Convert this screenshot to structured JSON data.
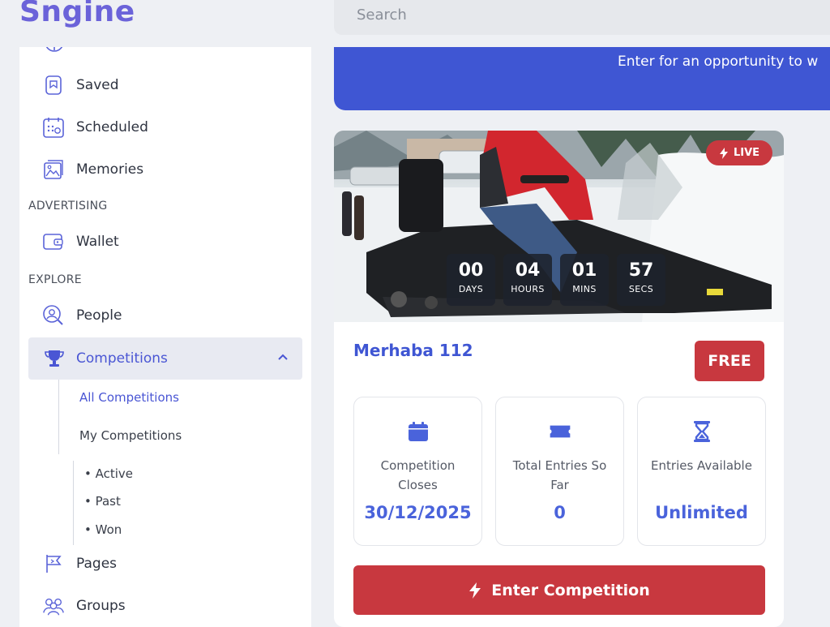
{
  "app": {
    "logo": "Sngine"
  },
  "search": {
    "placeholder": "Search"
  },
  "sidebar": {
    "items": [
      {
        "label": "Saved",
        "icon": "bookmark-icon"
      },
      {
        "label": "Scheduled",
        "icon": "calendar-icon"
      },
      {
        "label": "Memories",
        "icon": "photos-icon"
      }
    ],
    "section_advertising": "ADVERTISING",
    "wallet": {
      "label": "Wallet",
      "icon": "wallet-icon"
    },
    "section_explore": "EXPLORE",
    "people": {
      "label": "People",
      "icon": "people-search-icon"
    },
    "competitions": {
      "label": "Competitions",
      "icon": "trophy-icon",
      "expanded": true,
      "sub": {
        "all": "All Competitions",
        "mine": "My Competitions",
        "active": "• Active",
        "past": "• Past",
        "won": "• Won"
      }
    },
    "pages": {
      "label": "Pages",
      "icon": "flag-icon"
    },
    "groups": {
      "label": "Groups",
      "icon": "groups-icon"
    }
  },
  "banner": {
    "text": "Enter for an opportunity to w"
  },
  "competition": {
    "live_badge": "LIVE",
    "countdown": [
      {
        "value": "00",
        "unit": "DAYS"
      },
      {
        "value": "04",
        "unit": "HOURS"
      },
      {
        "value": "01",
        "unit": "MINS"
      },
      {
        "value": "57",
        "unit": "SECS"
      }
    ],
    "title": "Merhaba 112",
    "price_badge": "FREE",
    "stats": {
      "closes": {
        "label": "Competition Closes",
        "value": "30/12/2025"
      },
      "entries": {
        "label": "Total Entries So Far",
        "value": "0"
      },
      "available": {
        "label": "Entries Available",
        "value": "Unlimited"
      }
    },
    "enter_button": "Enter Competition"
  },
  "colors": {
    "brand": "#6b63d9",
    "primary": "#3f56d3",
    "danger": "#c8383f"
  }
}
